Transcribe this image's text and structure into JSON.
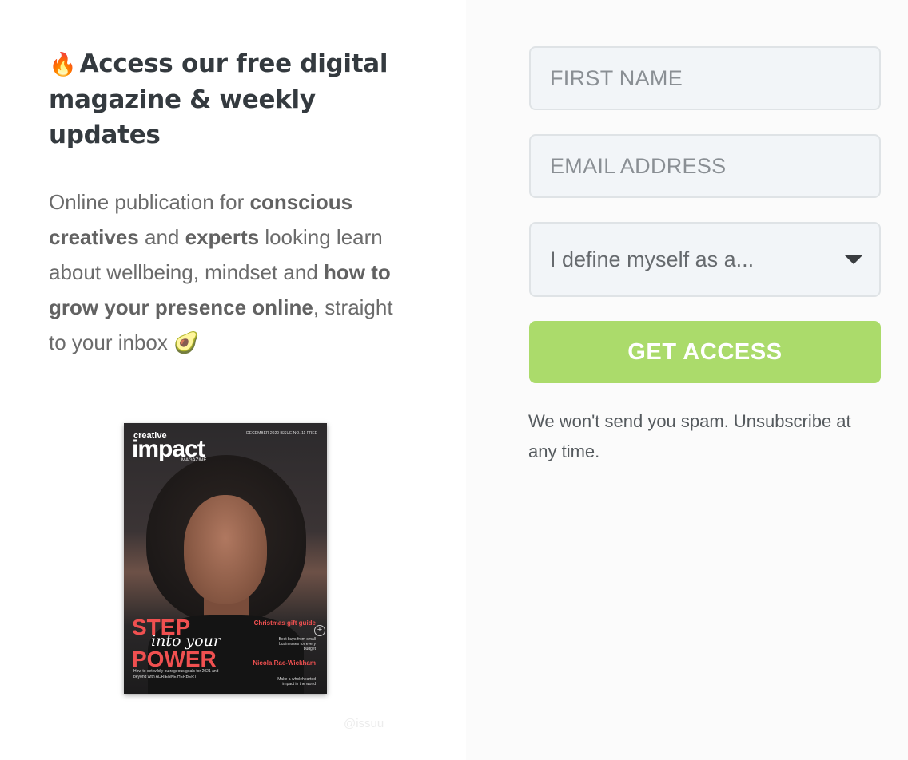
{
  "intro": {
    "fire_emoji": "🔥",
    "headline": "Access our free digital magazine & weekly updates",
    "description": {
      "t1": "Online publication for ",
      "b1": "conscious creatives",
      "t2": " and ",
      "b2": "experts",
      "t3": " looking learn about wellbeing, mindset and ",
      "b3": "how to grow your presence online",
      "t4": ", straight to your inbox ",
      "emoji": "🥑"
    }
  },
  "magazine": {
    "brand_small": "creative",
    "brand_big": "impact",
    "brand_label": "MAGAZINE",
    "issue": "DECEMBER 2020 ISSUE NO. 11 FREE",
    "cover_line_1": "STEP",
    "cover_line_2": "into your",
    "cover_line_3": "POWER",
    "tagline": "How to set wildly outrageous goals for 2021 and beyond with ADRIENNE HERBERT",
    "feature_1_title": "Christmas gift guide",
    "feature_1_sub": "Best buys from small businesses for every budget",
    "feature_2_title": "Nicola Rae-Wickham",
    "feature_2_sub": "Make a wholehearted impact in the world",
    "watermark": "@issuu"
  },
  "form": {
    "first_name_placeholder": "FIRST NAME",
    "email_placeholder": "EMAIL ADDRESS",
    "role_select_value": "I define myself as a...",
    "submit_label": "GET ACCESS",
    "note": "We won't send you spam. Unsubscribe at any time."
  },
  "colors": {
    "accent": "#abdb6b",
    "heading": "#343a3f",
    "field_bg": "#f2f5f8",
    "right_bg": "#fbfbfb"
  }
}
